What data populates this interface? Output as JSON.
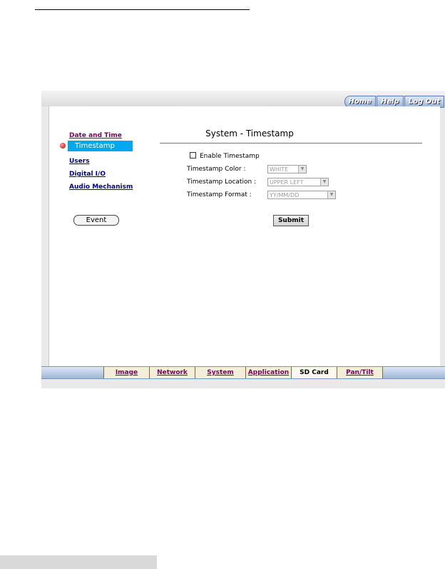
{
  "topnav": {
    "home": "Home",
    "help": "Help",
    "logout": "Log Out"
  },
  "sidebar": {
    "items": [
      {
        "label": "Date and Time"
      },
      {
        "label": "Timestamp"
      },
      {
        "label": "Users"
      },
      {
        "label": "Digital I/O"
      },
      {
        "label": "Audio Mechanism"
      }
    ],
    "event_button": "Event"
  },
  "main": {
    "title": "System - Timestamp",
    "enable_label": "Enable Timestamp",
    "color_label": "Timestamp Color :",
    "color_value": "WHITE",
    "location_label": "Timestamp Location :",
    "location_value": "UPPER LEFT",
    "format_label": "Timestamp Format :",
    "format_value": "YY/MM/DD",
    "submit_label": "Submit"
  },
  "bottom_nav": {
    "tabs": [
      {
        "label": "Image"
      },
      {
        "label": "Network"
      },
      {
        "label": "System"
      },
      {
        "label": "Application"
      },
      {
        "label": "SD Card"
      },
      {
        "label": "Pan/Tilt"
      }
    ]
  },
  "colors": {
    "active_item": "#00a8f0",
    "link": "#0000a0",
    "visited_link": "#800060"
  }
}
